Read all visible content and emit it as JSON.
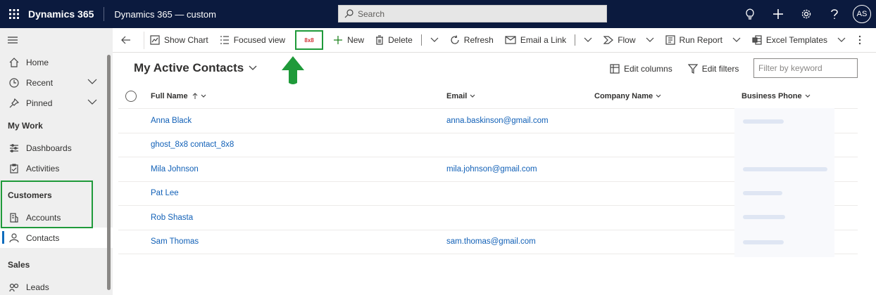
{
  "topbar": {
    "brand": "Dynamics 365",
    "app_name": "Dynamics 365 — custom",
    "search_placeholder": "Search",
    "avatar_initials": "AS",
    "bg_color": "#0b1a3e"
  },
  "sidebar": {
    "items": [
      {
        "label": "Home",
        "icon": "home-icon"
      },
      {
        "label": "Recent",
        "icon": "clock-icon"
      },
      {
        "label": "Pinned",
        "icon": "pin-icon"
      }
    ],
    "section_my_work": "My Work",
    "my_work_items": [
      {
        "label": "Dashboards",
        "icon": "dashboard-icon"
      },
      {
        "label": "Activities",
        "icon": "clipboard-icon"
      }
    ],
    "section_customers": "Customers",
    "customers_items": [
      {
        "label": "Accounts",
        "icon": "building-icon"
      },
      {
        "label": "Contacts",
        "icon": "person-icon",
        "selected": true
      }
    ],
    "section_sales": "Sales",
    "sales_items": [
      {
        "label": "Leads",
        "icon": "leads-icon"
      }
    ]
  },
  "commandbar": {
    "show_chart": "Show Chart",
    "focused_view": "Focused view",
    "eightxeight": "8x8",
    "new": "New",
    "delete": "Delete",
    "refresh": "Refresh",
    "email_link": "Email a Link",
    "flow": "Flow",
    "run_report": "Run Report",
    "excel_templates": "Excel Templates"
  },
  "view": {
    "title": "My Active Contacts",
    "edit_columns": "Edit columns",
    "edit_filters": "Edit filters",
    "filter_placeholder": "Filter by keyword"
  },
  "grid": {
    "columns": {
      "full_name": "Full Name",
      "email": "Email",
      "company": "Company Name",
      "phone": "Business Phone"
    },
    "rows": [
      {
        "name": "Anna Black",
        "email": "anna.baskinson@gmail.com"
      },
      {
        "name": "ghost_8x8 contact_8x8",
        "email": ""
      },
      {
        "name": "Mila Johnson",
        "email": "mila.johnson@gmail.com"
      },
      {
        "name": "Pat Lee",
        "email": ""
      },
      {
        "name": "Rob Shasta",
        "email": ""
      },
      {
        "name": "Sam Thomas",
        "email": "sam.thomas@gmail.com"
      }
    ]
  },
  "colors": {
    "highlight_green": "#1f9a3a",
    "link_blue": "#1160b7"
  }
}
